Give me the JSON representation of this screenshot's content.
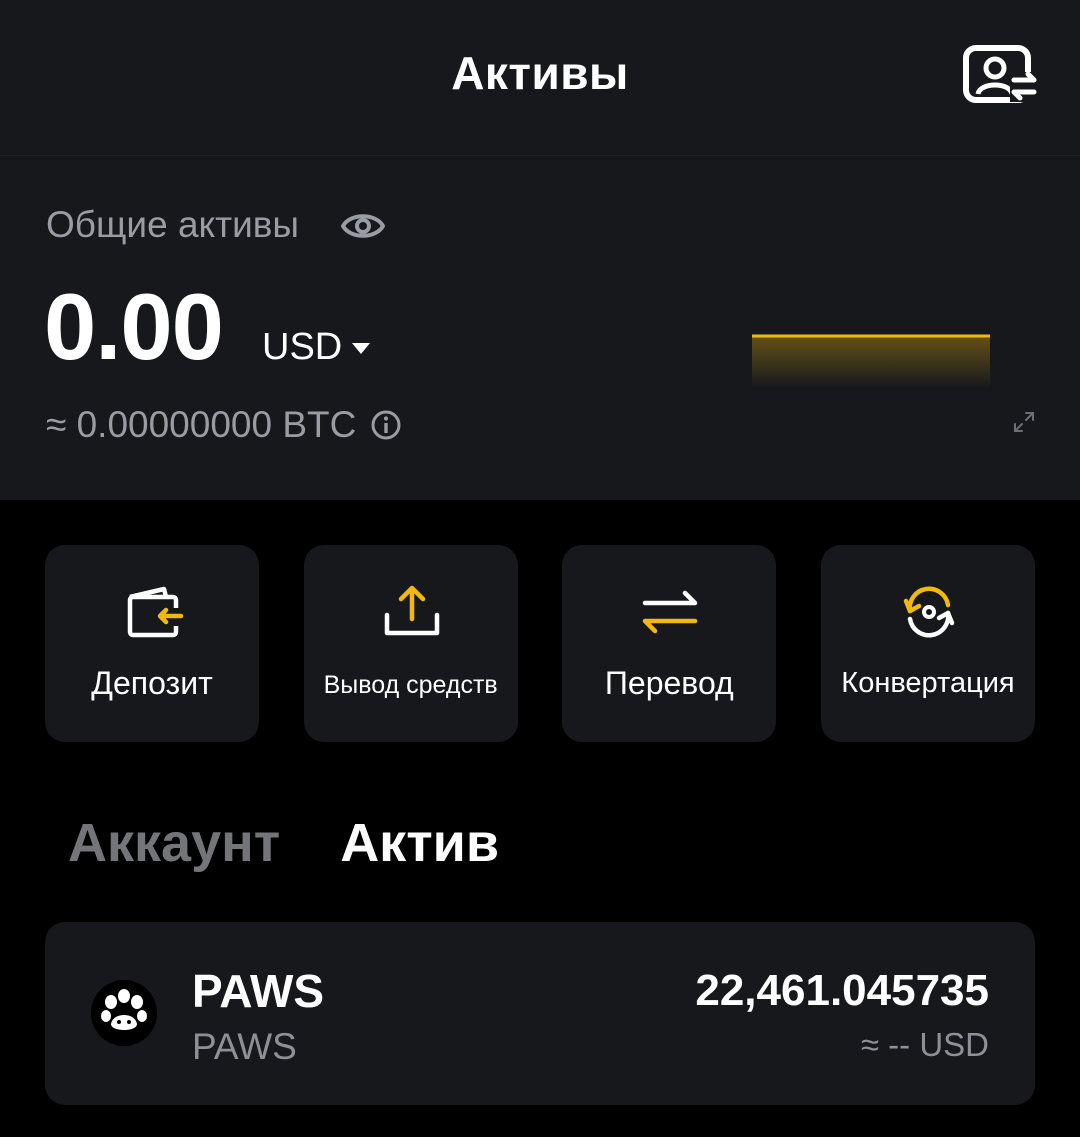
{
  "header": {
    "title": "Активы"
  },
  "summary": {
    "label": "Общие активы",
    "balance": "0.00",
    "currency": "USD",
    "btc_equivalent": "≈ 0.00000000 BTC"
  },
  "actions": [
    {
      "label": "Депозит",
      "icon": "deposit-wallet-icon"
    },
    {
      "label": "Вывод средств",
      "icon": "withdraw-upload-icon"
    },
    {
      "label": "Перевод",
      "icon": "transfer-arrows-icon"
    },
    {
      "label": "Конвертация",
      "icon": "convert-cycle-icon"
    }
  ],
  "tabs": [
    {
      "label": "Аккаунт",
      "active": false
    },
    {
      "label": "Актив",
      "active": true
    }
  ],
  "assets": [
    {
      "symbol": "PAWS",
      "name": "PAWS",
      "amount": "22,461.045735",
      "usd_value": "≈ -- USD",
      "icon": "paws-logo-icon"
    }
  ],
  "colors": {
    "accent": "#f0b90b",
    "panel": "#17181c",
    "background": "#000000",
    "muted_text": "#9a9ca3",
    "inactive_tab": "#737579"
  }
}
